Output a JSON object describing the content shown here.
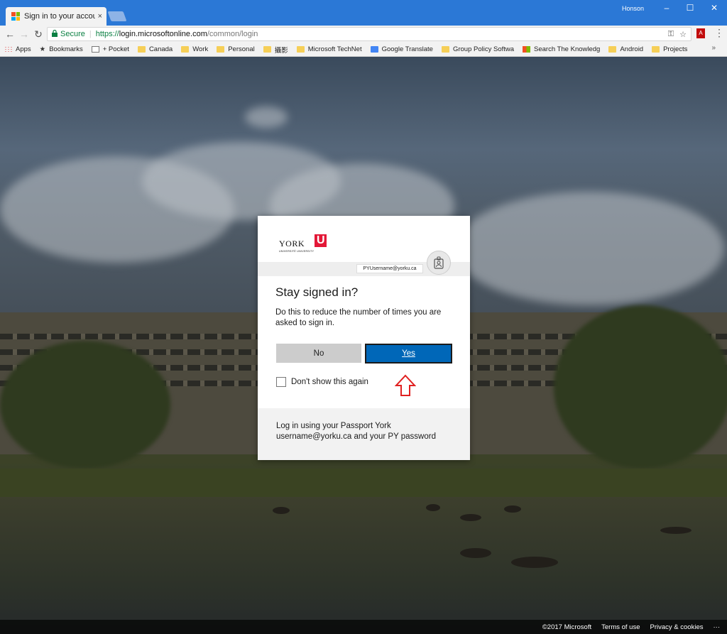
{
  "browser": {
    "tab_title": "Sign in to your account",
    "tab_close": "×",
    "profile_name": "Honson",
    "window_controls": {
      "minimize": "–",
      "maximize": "☐",
      "close": "✕"
    },
    "nav": {
      "back": "←",
      "forward": "→",
      "reload": "↻"
    },
    "security_label": "Secure",
    "url_scheme": "https://",
    "url_host": "login.microsoftonline.com",
    "url_path": "/common/login",
    "pdf_label": "A",
    "icons": [
      "key-icon",
      "star-icon",
      "pdf-icon",
      "menu-icon"
    ]
  },
  "bookmarks": {
    "items": [
      {
        "label": "Apps",
        "icon": "apps-grid-icon"
      },
      {
        "label": "Bookmarks",
        "icon": "star-icon"
      },
      {
        "label": "+ Pocket",
        "icon": "page-icon"
      },
      {
        "label": "Canada",
        "icon": "folder-icon"
      },
      {
        "label": "Work",
        "icon": "folder-icon"
      },
      {
        "label": "Personal",
        "icon": "folder-icon"
      },
      {
        "label": "攝影",
        "icon": "folder-icon"
      },
      {
        "label": "Microsoft TechNet",
        "icon": "folder-icon"
      },
      {
        "label": "Google Translate",
        "icon": "translate-icon"
      },
      {
        "label": "Group Policy Softwa",
        "icon": "folder-icon"
      },
      {
        "label": "Search The Knowledg",
        "icon": "microsoft-icon"
      },
      {
        "label": "Android",
        "icon": "folder-icon"
      },
      {
        "label": "Projects",
        "icon": "folder-icon"
      }
    ],
    "more": "»"
  },
  "dialog": {
    "logo_text": "YORK",
    "logo_subtext": "UNIVERSITÉ UNIVERSITY",
    "logo_mark": "U",
    "account": "PYUsername@yorku.ca",
    "title": "Stay signed in?",
    "description": "Do this to reduce the number of times you are asked to sign in.",
    "no_label": "No",
    "yes_label": "Yes",
    "checkbox_label": "Don't show this again",
    "checkbox_checked": false,
    "footer_text": "Log in using your Passport York username@yorku.ca and your PY password",
    "accent_color": "#0067b8",
    "annotation_color": "#e02020"
  },
  "footer": {
    "copyright": "©2017 Microsoft",
    "terms": "Terms of use",
    "privacy": "Privacy & cookies",
    "more": "···"
  }
}
